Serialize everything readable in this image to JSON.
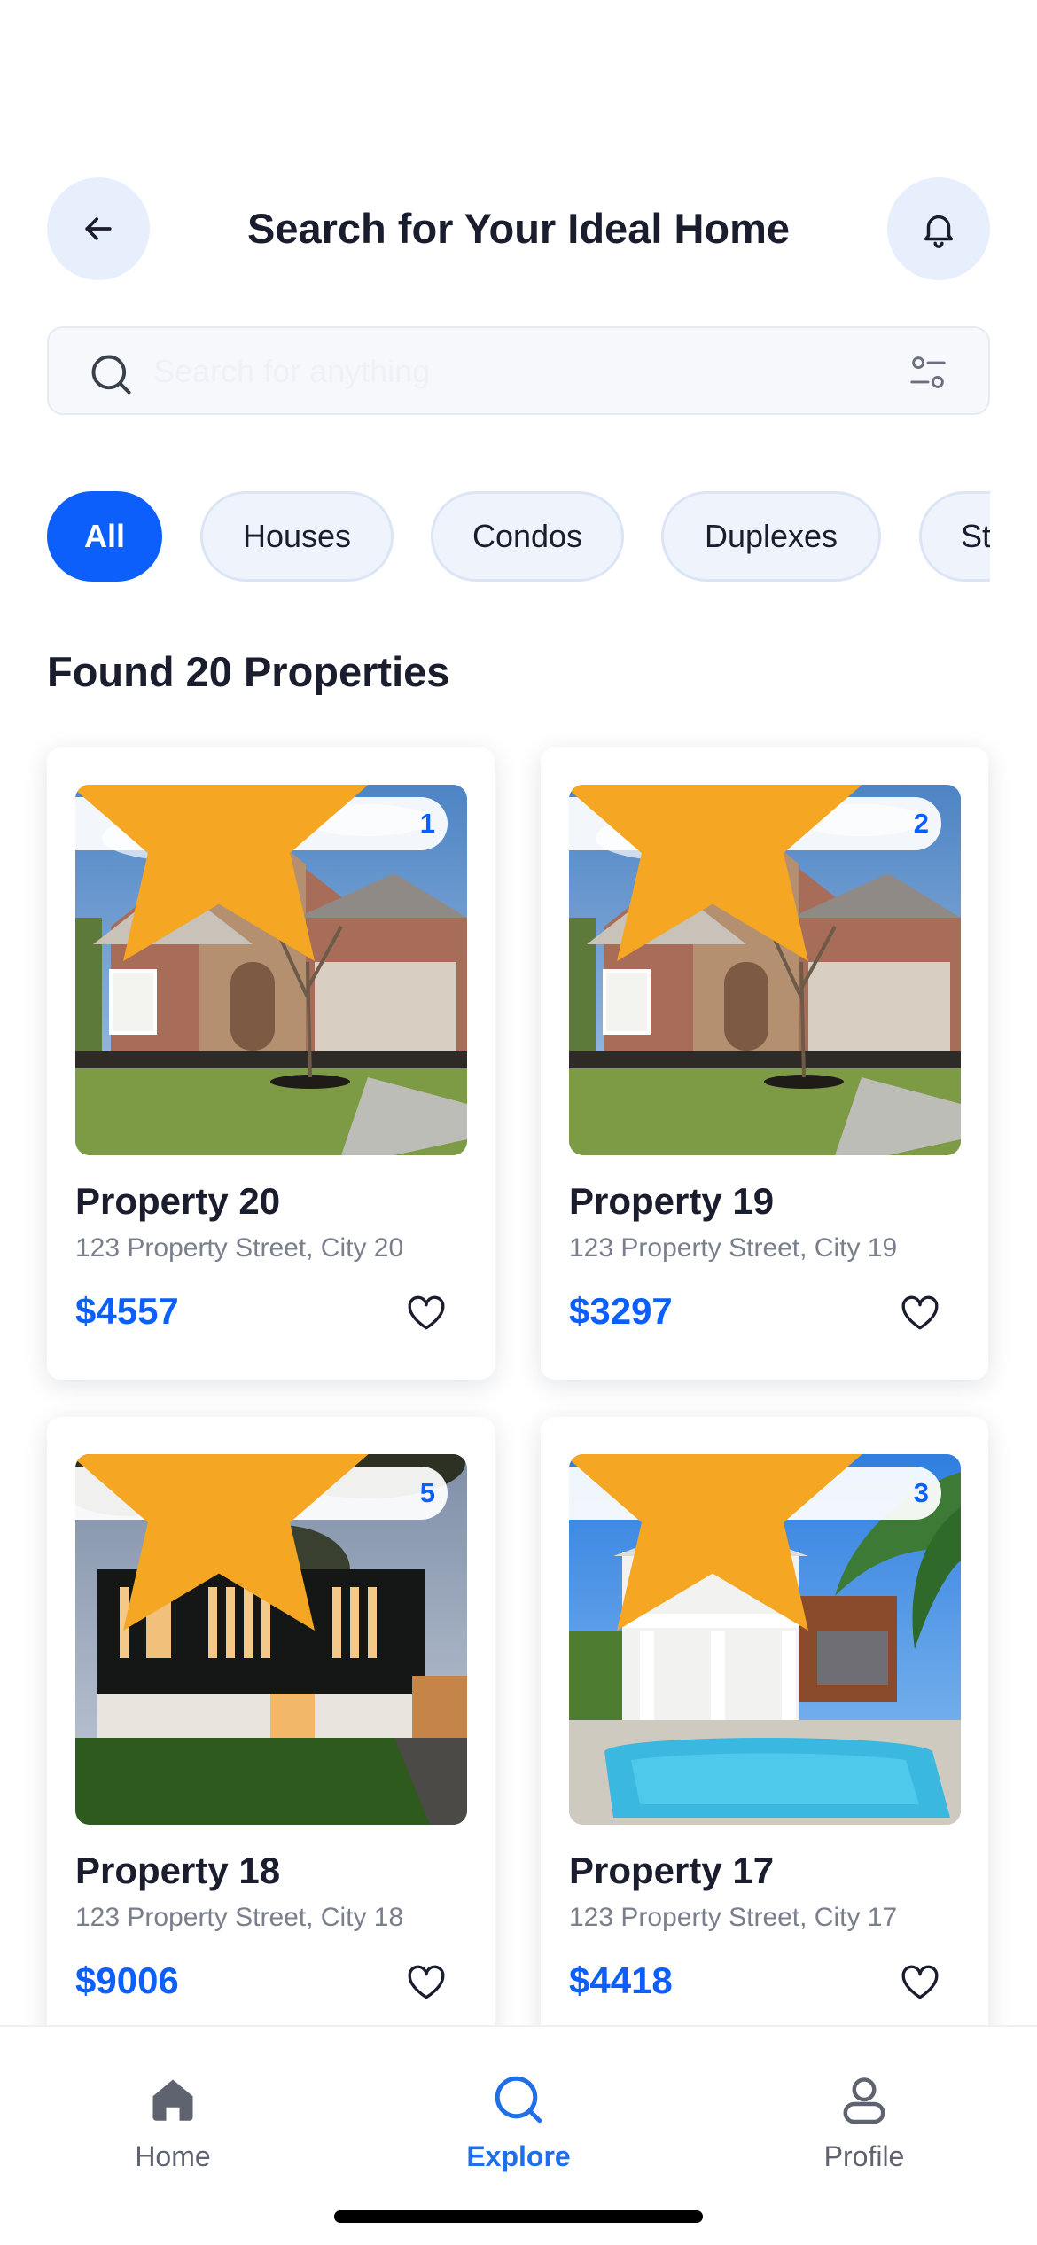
{
  "header": {
    "title": "Search for Your Ideal Home",
    "back_icon": "arrow-left-icon",
    "bell_icon": "bell-icon"
  },
  "search": {
    "placeholder": "Search for anything",
    "value": "",
    "search_icon": "search-icon",
    "filter_icon": "filter-icon"
  },
  "categories": [
    {
      "label": "All",
      "active": true
    },
    {
      "label": "Houses",
      "active": false
    },
    {
      "label": "Condos",
      "active": false
    },
    {
      "label": "Duplexes",
      "active": false
    },
    {
      "label": "St",
      "active": false
    }
  ],
  "results": {
    "title": "Found 20 Properties"
  },
  "properties": [
    {
      "name": "Property 20",
      "address": "123 Property Street, City 20",
      "price": "$4557",
      "rating": "1",
      "photo": "brick-house",
      "favorite": false
    },
    {
      "name": "Property 19",
      "address": "123 Property Street, City 19",
      "price": "$3297",
      "rating": "2",
      "photo": "brick-house",
      "favorite": false
    },
    {
      "name": "Property 18",
      "address": "123 Property Street, City 18",
      "price": "$9006",
      "rating": "5",
      "photo": "modern-house-dusk",
      "favorite": false
    },
    {
      "name": "Property 17",
      "address": "123 Property Street, City 17",
      "price": "$4418",
      "rating": "3",
      "photo": "villa-with-pool",
      "favorite": false
    }
  ],
  "bottom_nav": [
    {
      "label": "Home",
      "icon": "home-icon",
      "active": false
    },
    {
      "label": "Explore",
      "icon": "search-icon",
      "active": true
    },
    {
      "label": "Profile",
      "icon": "user-icon",
      "active": false
    }
  ],
  "colors": {
    "accent": "#0d5ffb",
    "chip_bg": "#eff4fc",
    "circle_btn_bg": "#e8effc",
    "star": "#f5a623",
    "text_dark": "#1a1d2e",
    "text_muted": "#7a7f8c"
  }
}
